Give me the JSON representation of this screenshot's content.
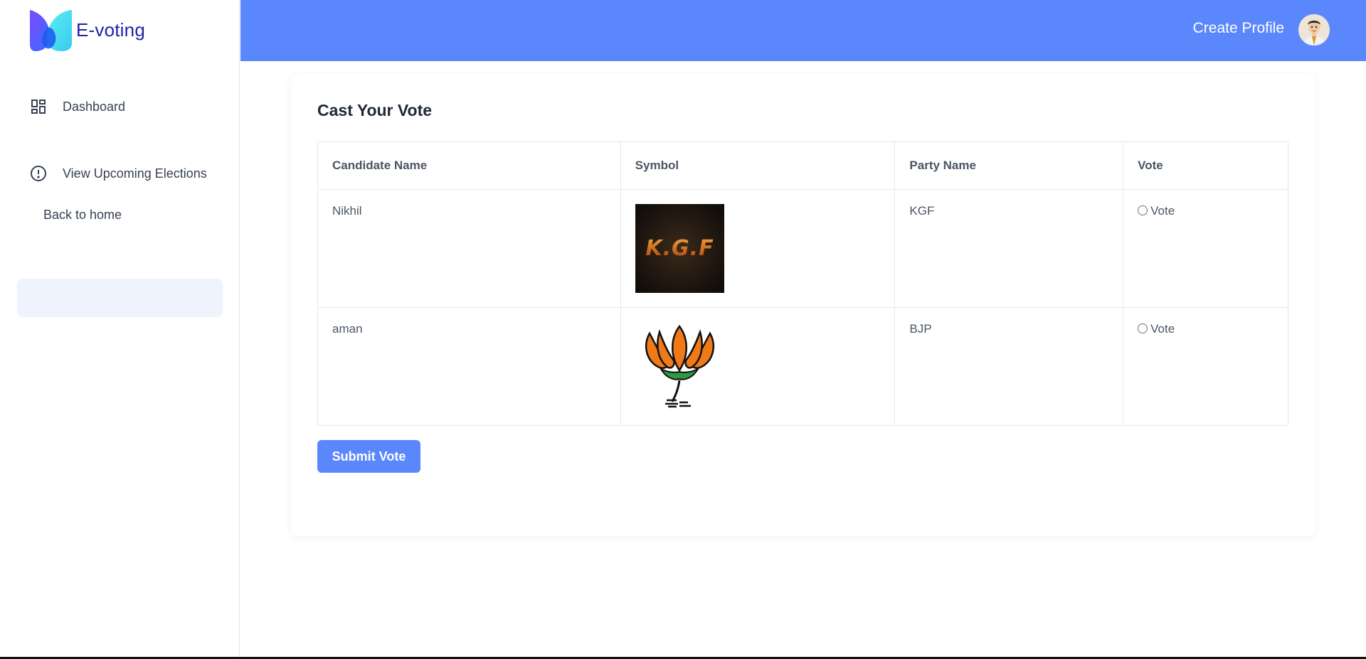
{
  "brand": {
    "name": "E-voting",
    "logo_icon": "butterfly-logo-icon",
    "color": "#1e22aa"
  },
  "sidebar": {
    "items": [
      {
        "label": "Dashboard",
        "icon": "dashboard-grid-icon"
      },
      {
        "label": "View Upcoming Elections",
        "icon": "info-circle-icon"
      },
      {
        "label": "Back to home"
      }
    ]
  },
  "header": {
    "create_profile": "Create Profile",
    "accent": "#5b87fc"
  },
  "main": {
    "title": "Cast Your Vote",
    "table": {
      "headers": [
        "Candidate Name",
        "Symbol",
        "Party Name",
        "Vote"
      ],
      "rows": [
        {
          "candidate": "Nikhil",
          "symbol": "kgf-logo-image",
          "party": "KGF",
          "vote_label": "Vote"
        },
        {
          "candidate": "aman",
          "symbol": "lotus-image",
          "party": "BJP",
          "vote_label": "Vote"
        }
      ]
    },
    "submit_label": "Submit Vote"
  }
}
